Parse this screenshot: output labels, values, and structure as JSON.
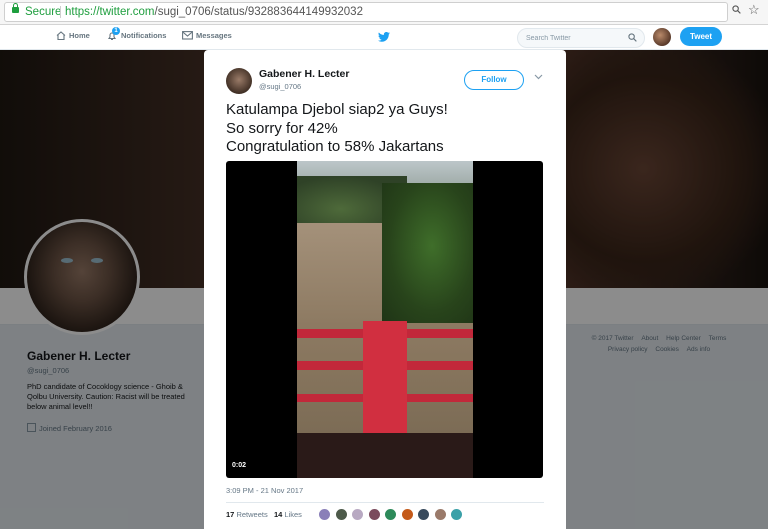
{
  "browser": {
    "secure_label": "Secure",
    "url_scheme": "https://",
    "url_host": "twitter.com",
    "url_path": "/sugi_0706/status/932883644149932032"
  },
  "nav": {
    "home": "Home",
    "notifications": "Notifications",
    "notifications_badge": "1",
    "messages": "Messages",
    "search_placeholder": "Search Twitter",
    "tweet_button": "Tweet"
  },
  "profile": {
    "name": "Gabener H. Lecter",
    "handle": "@sugi_0706",
    "bio": "PhD candidate of Cocoklogy science - Ghoib & Qolbu University. Caution: Racist will be treated below animal level!!",
    "joined": "Joined February 2016"
  },
  "footer": {
    "line1": [
      "© 2017 Twitter",
      "About",
      "Help Center",
      "Terms"
    ],
    "line2": [
      "Privacy policy",
      "Cookies",
      "Ads info"
    ]
  },
  "tweet": {
    "author_name": "Gabener H. Lecter",
    "author_handle": "@sugi_0706",
    "follow_label": "Follow",
    "text_lines": [
      "Katulampa Djebol siap2 ya Guys!",
      "So sorry for 42%",
      "Congratulation to 58% Jakartans"
    ],
    "video_time": "0:02",
    "timestamp": "3:09 PM - 21 Nov 2017",
    "retweets_count": "17",
    "retweets_label": "Retweets",
    "likes_count": "14",
    "likes_label": "Likes"
  },
  "colors": {
    "accent": "#1da1f2",
    "secure_green": "#1e9e3e"
  },
  "liker_colors": [
    "#8a7fb8",
    "#4d5a4a",
    "#b8a9c2",
    "#7a4a5c",
    "#2d8a5a",
    "#c45a1a",
    "#384a5c",
    "#9a7a6a",
    "#3aa0a8"
  ]
}
